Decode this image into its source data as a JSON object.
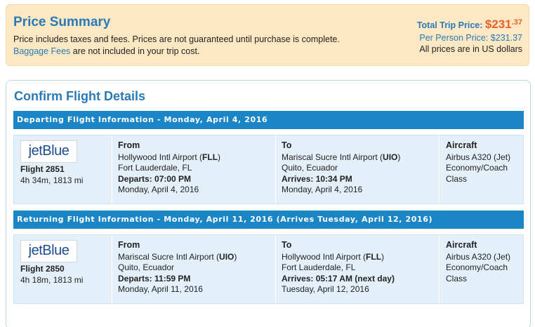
{
  "summary": {
    "title": "Price Summary",
    "line1": "Price includes taxes and fees. Prices are not guaranteed until purchase is complete.",
    "baggage_link": "Baggage Fees",
    "line2_rest": " are not included in your trip cost.",
    "total_label": "Total Trip Price:",
    "total_dollars": "$231",
    "total_cents": ".37",
    "per_person": "Per Person Price: $231.37",
    "currency_note": "All prices are in US dollars"
  },
  "confirm": {
    "title": "Confirm Flight Details"
  },
  "segments": [
    {
      "header": "Departing Flight Information - Monday, April 4, 2016",
      "airline_logo": "jetBlue",
      "flight": "Flight 2851",
      "duration": "4h 34m, 1813 mi",
      "from_label": "From",
      "from_airport_name": "Hollywood Intl Airport (",
      "from_code": "FLL",
      "from_city": "Fort Lauderdale, FL",
      "depart_label": "Departs:",
      "depart_time": "07:00 PM",
      "depart_date": "Monday, April 4, 2016",
      "to_label": "To",
      "to_airport_name": "Mariscal Sucre Intl Airport (",
      "to_code": "UIO",
      "to_city": "Quito, Ecuador",
      "arrive_label": "Arrives:",
      "arrive_time": "10:34 PM",
      "arrive_date": "Monday, April 4, 2016",
      "aircraft_label": "Aircraft",
      "aircraft": "Airbus A320 (Jet)",
      "cabin": "Economy/Coach",
      "cabin2": "Class"
    },
    {
      "header": "Returning Flight Information - Monday, April 11, 2016 (Arrives Tuesday, April 12, 2016)",
      "airline_logo": "jetBlue",
      "flight": "Flight 2850",
      "duration": "4h 18m, 1813 mi",
      "from_label": "From",
      "from_airport_name": "Mariscal Sucre Intl Airport (",
      "from_code": "UIO",
      "from_city": "Quito, Ecuador",
      "depart_label": "Departs:",
      "depart_time": "11:59 PM",
      "depart_date": "Monday, April 11, 2016",
      "to_label": "To",
      "to_airport_name": "Hollywood Intl Airport (",
      "to_code": "FLL",
      "to_city": "Fort Lauderdale, FL",
      "arrive_label": "Arrives:",
      "arrive_time": "05:17 AM (next day)",
      "arrive_date": "Tuesday, April 12, 2016",
      "aircraft_label": "Aircraft",
      "aircraft": "Airbus A320 (Jet)",
      "cabin": "Economy/Coach",
      "cabin2": "Class"
    }
  ]
}
